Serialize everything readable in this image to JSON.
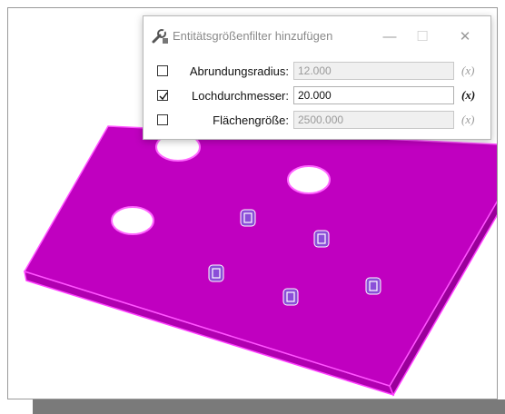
{
  "dialog": {
    "title": "Entitätsgrößenfilter hinzufügen",
    "icon": "wrench-filter-icon",
    "buttons": {
      "minimize": "—",
      "maximize": "☐",
      "close": "✕"
    }
  },
  "filters": [
    {
      "label": "Abrundungsradius:",
      "value": "12.000",
      "checked": false,
      "fx": "(x)"
    },
    {
      "label": "Lochdurchmesser:",
      "value": "20.000",
      "checked": true,
      "fx": "(x)"
    },
    {
      "label": "Flächengröße:",
      "value": "2500.000",
      "checked": false,
      "fx": "(x)"
    }
  ],
  "colors": {
    "part": "#c000c0",
    "edge": "#ff33ff",
    "hole_fill": "#ffffff"
  }
}
